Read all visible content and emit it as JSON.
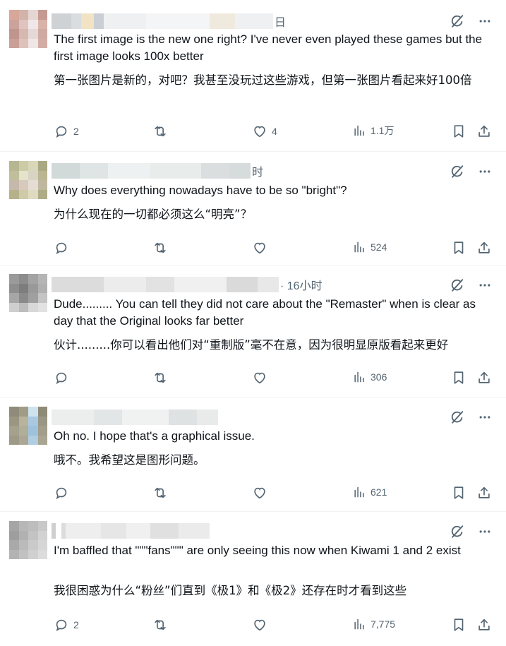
{
  "replies": [
    {
      "meta": "日",
      "text": "The first image is the new one right? I've never even played these games but the first image looks 100x better",
      "translation": "第一张图片是新的，对吧？我甚至没玩过这些游戏，但第一张图片看起来好100倍",
      "replies": "2",
      "reposts": "",
      "likes": "4",
      "views": "1.1万"
    },
    {
      "meta": "时",
      "text": "Why does everything nowadays have to be so \"bright\"?",
      "translation": "为什么现在的一切都必须这么“明亮”？",
      "replies": "",
      "reposts": "",
      "likes": "",
      "views": "524"
    },
    {
      "meta": "· 16小时",
      "text": "Dude......... You can tell they did not care about the \"Remaster\" when is clear as day that the Original looks far better",
      "translation": "伙计.........你可以看出他们对“重制版”毫不在意，因为很明显原版看起来更好",
      "replies": "",
      "reposts": "",
      "likes": "",
      "views": "306"
    },
    {
      "meta": "",
      "text": "Oh no. I hope that's a graphical issue.",
      "translation": "哦不。我希望这是图形问题。",
      "replies": "",
      "reposts": "",
      "likes": "",
      "views": "621"
    },
    {
      "meta": "",
      "text": "I'm baffled that \"\"\"fans\"\"\" are only seeing this now when Kiwami 1 and 2 exist",
      "translation": "我很困惑为什么“粉丝”们直到《极1》和《极2》还存在时才看到这些",
      "replies": "2",
      "reposts": "",
      "likes": "",
      "views": "7,775"
    }
  ],
  "icons": {
    "grok": "grok-icon",
    "more": "more-icon",
    "reply": "reply-icon",
    "repost": "repost-icon",
    "like": "like-icon",
    "views": "views-icon",
    "bookmark": "bookmark-icon",
    "share": "share-icon"
  },
  "colors": {
    "icon": "#536471",
    "text": "#0f1419",
    "divider": "#eff3f4"
  }
}
